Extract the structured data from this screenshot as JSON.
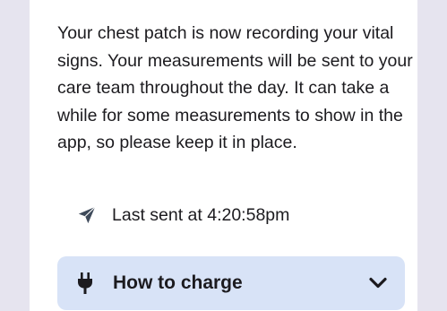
{
  "card": {
    "message": "Your chest patch is now recording your vital signs. Your measurements will be sent to your care team throughout the day. It can take a while for some measurements to show in the app, so please keep it in place.",
    "status": {
      "icon": "send-icon",
      "text": "Last sent at 4:20:58pm"
    },
    "accordion": {
      "icon": "plug-icon",
      "title": "How to charge",
      "expand_icon": "chevron-down-icon",
      "expanded": false
    }
  },
  "colors": {
    "side_panel": "#e6e4ef",
    "card_background": "#ffffff",
    "accordion_background": "#d8e3f7",
    "text": "#1c1b1f",
    "icon": "#3e4a5a"
  }
}
